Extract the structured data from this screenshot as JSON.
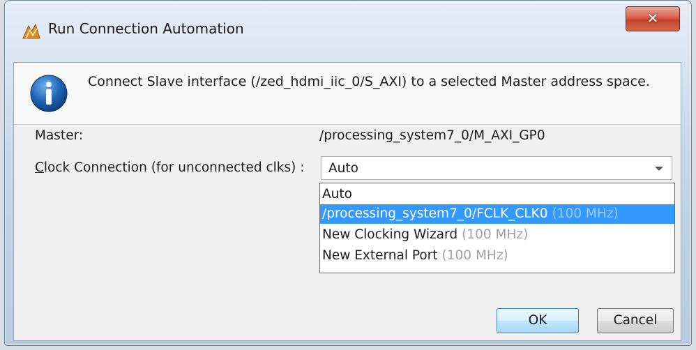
{
  "window": {
    "title": "Run Connection Automation",
    "close_glyph": "✕",
    "icon": "vivado-logo-icon"
  },
  "header": {
    "icon": "info-icon",
    "message": "Connect Slave interface (/zed_hdmi_iic_0/S_AXI) to a selected Master address space."
  },
  "form": {
    "master_label": "Master:",
    "master_value": "/processing_system7_0/M_AXI_GP0",
    "clock_label_mnemonic": "C",
    "clock_label_rest": "lock Connection (for unconnected clks) :",
    "clock_selected": "Auto"
  },
  "dropdown": {
    "options": [
      {
        "label": "Auto",
        "freq": ""
      },
      {
        "label": "/processing_system7_0/FCLK_CLK0",
        "freq": "(100 MHz)",
        "selected": true
      },
      {
        "label": "New Clocking Wizard",
        "freq": "(100 MHz)"
      },
      {
        "label": "New External Port",
        "freq": "(100 MHz)"
      }
    ]
  },
  "buttons": {
    "ok": "OK",
    "cancel": "Cancel"
  },
  "colors": {
    "selection": "#3399ff",
    "info_blue": "#1e63b4",
    "close_red": "#c2402c"
  }
}
